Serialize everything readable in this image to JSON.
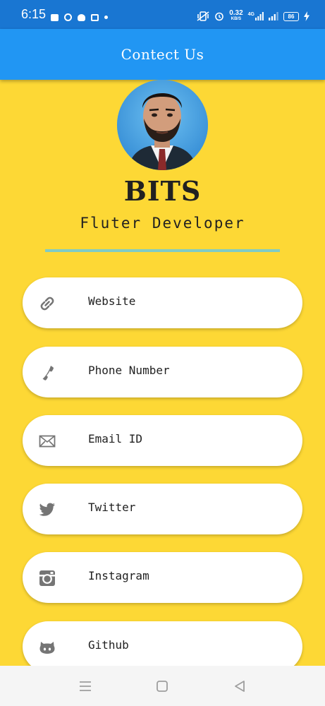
{
  "status_bar": {
    "time": "6:15",
    "speed_value": "0.32",
    "speed_unit": "KB/S",
    "network_label": "4G",
    "battery": "86"
  },
  "app_bar": {
    "title": "Contect Us"
  },
  "profile": {
    "name": "BITS",
    "role": "Fluter Developer"
  },
  "contacts": [
    {
      "label": "Website",
      "icon": "link-icon"
    },
    {
      "label": "Phone Number",
      "icon": "phone-icon"
    },
    {
      "label": "Email ID",
      "icon": "email-icon"
    },
    {
      "label": "Twitter",
      "icon": "twitter-icon"
    },
    {
      "label": "Instagram",
      "icon": "instagram-icon"
    },
    {
      "label": "Github",
      "icon": "github-icon"
    }
  ],
  "nav": {
    "menu_icon": "menu-icon",
    "home_icon": "home-square-icon",
    "back_icon": "back-triangle-icon"
  },
  "colors": {
    "status_bar": "#1976D2",
    "app_bar": "#2196F3",
    "background": "#FDD835",
    "divider": "#80CBC4",
    "card": "#FFFFFF",
    "icon_gray": "#757575"
  }
}
